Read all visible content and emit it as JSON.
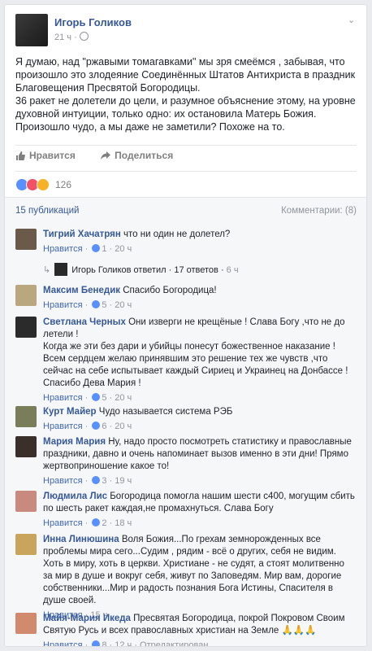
{
  "post": {
    "author": "Игорь Голиков",
    "time": "21 ч",
    "body": [
      "Я думаю, над \"ржавыми томагавками\" мы зря смеёмся , забывая, что произошло это злодеяние Соединённых Штатов Антихриста в праздник Благовещения Пресвятой Богородицы.",
      "36 ракет не долетели до цели, и разумное объяснение этому, на уровне духовной интуиции, только одно: их остановила Матерь Божия. Произошло чудо, а мы даже не заметили? Похоже на то."
    ],
    "like_label": "Нравится",
    "share_label": "Поделиться",
    "reaction_count": "126"
  },
  "comments_header": {
    "publications": "15 публикаций",
    "comments": "Комментарии: (8)"
  },
  "comments": [
    {
      "name": "Тигрий Хачатрян",
      "text": "что ни один не долетел?",
      "like": "Нравится",
      "likes": "1",
      "time": "20 ч",
      "avatar_color": "#6b5a4a"
    },
    {
      "name": "Максим Бенедик",
      "text": "Спасибо Богородица!",
      "like": "Нравится",
      "likes": "5",
      "time": "20 ч",
      "avatar_color": "#b9a77f"
    },
    {
      "name": "Светлана Черных",
      "text": "Они изверги не крещёные ! Слава Богу ,что не до летели !\nКогда же эти без дари и убийцы понесут божественное наказание ! Всем сердцем желаю принявшим это решение тех же чувств ,что сейчас на себе испытывает каждый Сириец и Украинец на Донбассе ! Спасибо Дева Мария !",
      "like": "Нравится",
      "likes": "5",
      "time": "20 ч",
      "avatar_color": "#2b2b2b"
    },
    {
      "name": "Курт Майер",
      "text": "Чудо называется система РЭБ",
      "like": "Нравится",
      "likes": "6",
      "time": "20 ч",
      "avatar_color": "#7a7d5a"
    },
    {
      "name": "Мария Мария",
      "text": "Ну, надо просто посмотреть статистику и православные праздники, давно и очень напоминает вызов именно в эти дни! Прямо жертвоприношение какое то!",
      "like": "Нравится",
      "likes": "3",
      "time": "19 ч",
      "avatar_color": "#3a2f2a"
    },
    {
      "name": "Людмила Лис",
      "text": "Богородица помогла нашим шести с400, могущим сбить по шесть ракет каждая,не промахнуться. Слава Богу",
      "like": "Нравится",
      "likes": "2",
      "time": "18 ч",
      "avatar_color": "#c88a7e"
    },
    {
      "name": "Инна Линюшина",
      "text": "Воля Божия...По грехам земнорожденных все проблемы мира сего...Судим , рядим - всё о других, себя не видим. Хоть в миру, хоть в церкви. Христиане - не судят, а стоят молитвенно за мир в душе и вокруг себя, живут по Заповедям. Мир вам, дорогие собственники...Мир и радость познания Бога Истины, Спасителя в душе своей.",
      "like": "Нравится",
      "likes": "",
      "time": "15 ч",
      "avatar_color": "#c9a45c"
    },
    {
      "name": "Майя-Мария Икеда",
      "text": "Пресвятая Богородица, покрой Покровом Своим Святую Русь и всех православных христиан на Земле 🙏🙏🙏",
      "like": "Нравится",
      "likes": "8",
      "time": "12 ч",
      "edited": "Отредактирован",
      "avatar_color": "#d28a6e"
    }
  ],
  "reply": {
    "author": "Игорь Голиков",
    "text": "ответил",
    "count": "17 ответов",
    "time": "6 ч"
  }
}
